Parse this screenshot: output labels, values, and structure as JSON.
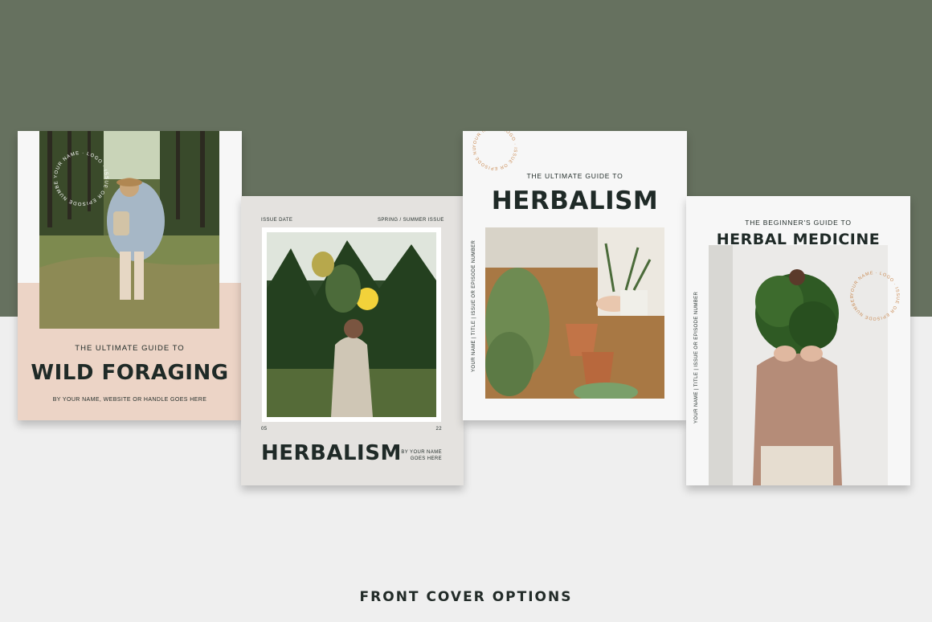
{
  "cover1": {
    "circle_text": "YOUR NAME · LOGO · ISSUE OR EPISODE NUMBER ·",
    "kicker": "THE ULTIMATE GUIDE TO",
    "title": "WILD FORAGING",
    "byline": "BY YOUR NAME, WEBSITE OR HANDLE GOES HERE"
  },
  "cover2": {
    "issue_date": "ISSUE DATE",
    "season": "SPRING / SUMMER ISSUE",
    "num_left": "05",
    "num_right": "22",
    "title": "HERBALISM",
    "byline_line1": "BY YOUR NAME",
    "byline_line2": "GOES HERE"
  },
  "cover3": {
    "circle_text": "YOUR NAME · LOGO · ISSUE OR EPISODE NUMBER ·",
    "kicker": "THE ULTIMATE GUIDE TO",
    "title": "HERBALISM",
    "vertical_text": "YOUR NAME | TITLE | ISSUE OR EPISODE NUMBER"
  },
  "cover4": {
    "kicker": "THE BEGINNER'S GUIDE TO",
    "title": "HERBAL MEDICINE",
    "circle_text": "YOUR NAME · LOGO · ISSUE OR EPISODE NUMBER ·",
    "vertical_text": "YOUR NAME | TITLE | ISSUE OR EPISODE NUMBER"
  },
  "footer": {
    "label": "FRONT COVER OPTIONS"
  },
  "colors": {
    "sage": "#66715f",
    "blush": "#ecd4c6",
    "paper": "#f6f6f6",
    "grey_panel": "#e4e2df",
    "ink": "#1f2a27",
    "accent": "#c98a52"
  }
}
